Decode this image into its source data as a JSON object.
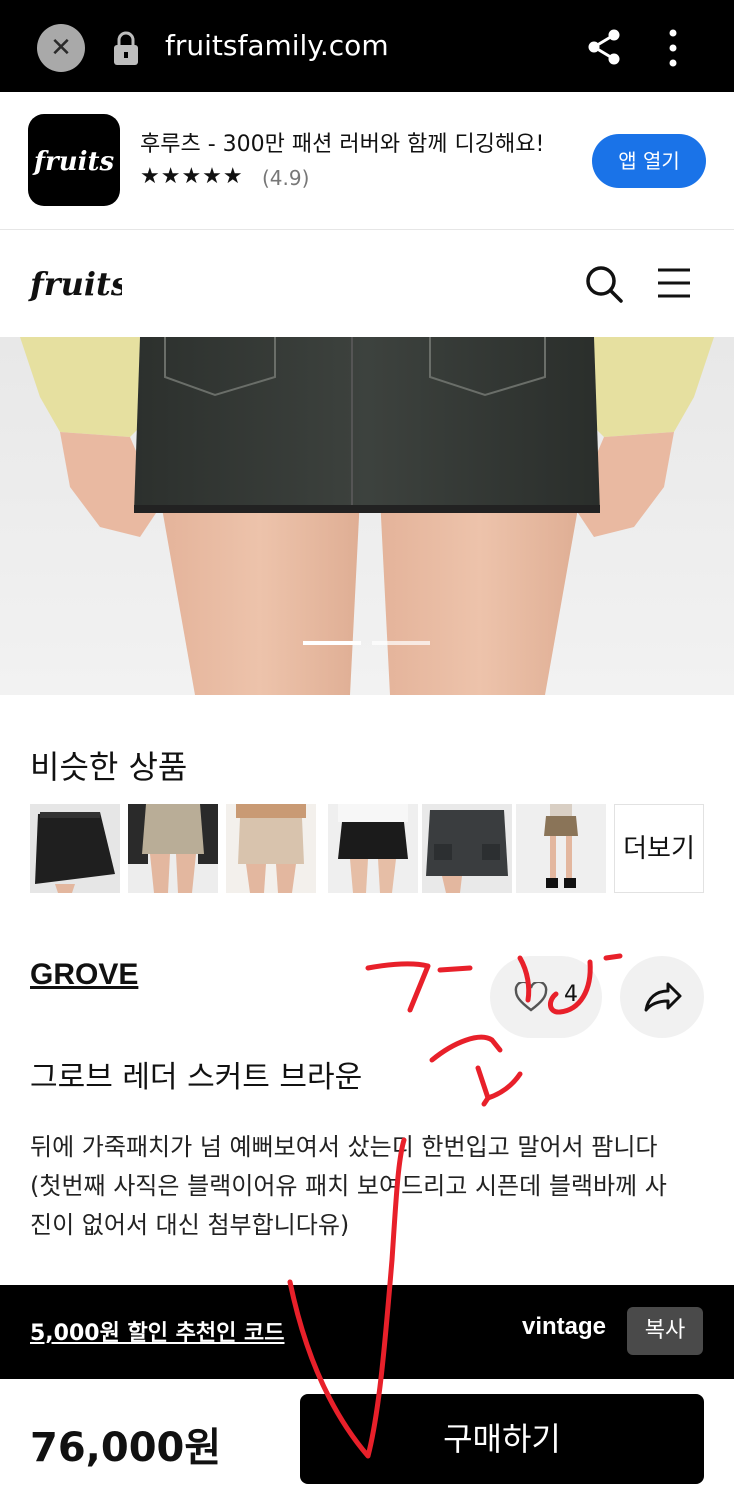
{
  "browser": {
    "url": "fruitsfamily.com",
    "close_icon": "close-icon",
    "lock_icon": "lock-icon",
    "share_icon": "share-icon",
    "menu_icon": "kebab-menu-icon"
  },
  "app_banner": {
    "title": "후루츠 - 300만 패션 러버와 함께 디깅해요!",
    "stars": "★★★★★",
    "rating": "(4.9)",
    "open_button": "앱 열기",
    "button_color": "#1a73e8"
  },
  "site_header": {
    "logo": "fruits",
    "search_icon": "search-icon",
    "menu_icon": "hamburger-menu-icon"
  },
  "carousel": {
    "slides": 2,
    "active": 1
  },
  "similar": {
    "title": "비슷한 상품",
    "more_label": "더보기",
    "items": [
      "black-leather-skirt",
      "beige-skirt",
      "cream-leather-skirt",
      "black-mini-skirt",
      "denim-cargo-skirt",
      "brown-mini-skirt"
    ]
  },
  "product": {
    "brand": "GROVE",
    "like_count": "4",
    "name": "그로브 레더 스커트 브라운",
    "description": "뒤에 가죽패치가 넘 예뻐보여서 샀는디 한번입고 말어서 팜니다\n(첫번째 사직은 블랙이어유 패치 보여드리고 시픈데 블랙바께 사진이 없어서 대신 첨부합니다유)"
  },
  "coupon": {
    "text": "5,000원 할인 추천인 코드",
    "code": "vintage",
    "copy_label": "복사"
  },
  "purchase": {
    "price": "76,000원",
    "buy_label": "구매하기"
  },
  "annotation": {
    "color": "#e8202a"
  }
}
